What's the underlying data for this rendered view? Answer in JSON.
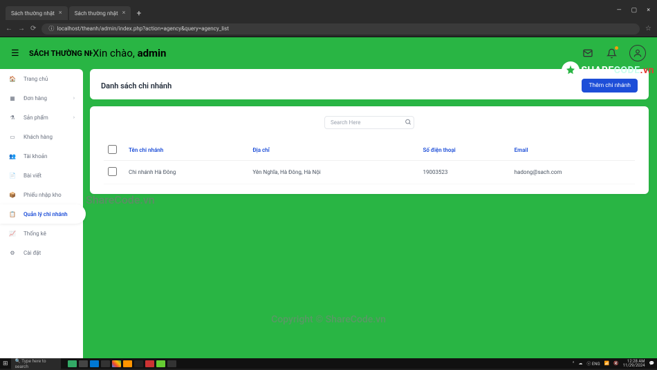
{
  "browser": {
    "tabs": [
      {
        "title": "Sách thường nhật"
      },
      {
        "title": "Sách thường nhật"
      }
    ],
    "url": "localhost/theanh/admin/index.php?action=agency&query=agency_list"
  },
  "header": {
    "brand": "SÁCH THƯỜNG NHẬT",
    "greeting_prefix": "Xin chào, ",
    "greeting_user": "admin"
  },
  "sidebar": {
    "items": [
      {
        "label": "Trang chủ",
        "icon": "home",
        "expandable": false
      },
      {
        "label": "Đơn hàng",
        "icon": "grid",
        "expandable": true
      },
      {
        "label": "Sản phẩm",
        "icon": "flask",
        "expandable": true
      },
      {
        "label": "Khách hàng",
        "icon": "card",
        "expandable": false
      },
      {
        "label": "Tài khoản",
        "icon": "users",
        "expandable": false
      },
      {
        "label": "Bài viết",
        "icon": "doc",
        "expandable": false
      },
      {
        "label": "Phiếu nhập kho",
        "icon": "box",
        "expandable": false
      },
      {
        "label": "Quản lý chi nhánh",
        "icon": "list",
        "expandable": false,
        "active": true
      },
      {
        "label": "Thống kê",
        "icon": "chart",
        "expandable": false
      },
      {
        "label": "Cài đặt",
        "icon": "gear",
        "expandable": false
      }
    ]
  },
  "page": {
    "title": "Danh sách chi nhánh",
    "add_button": "Thêm chi nhánh",
    "search_placeholder": "Search Here",
    "columns": {
      "name": "Tên chi nhánh",
      "address": "Địa chỉ",
      "phone": "Số điện thoại",
      "email": "Email"
    },
    "rows": [
      {
        "name": "Chi nhánh Hà Đông",
        "address": "Yên Nghĩa, Hà Đông, Hà Nội",
        "phone": "19003523",
        "email": "hadong@sach.com"
      }
    ]
  },
  "watermarks": {
    "wm1": "ShareCode.vn",
    "wm2": "Copyright © ShareCode.vn",
    "logo_share": "SHARE",
    "logo_code": "CODE",
    "logo_vn": ".vn"
  },
  "taskbar": {
    "search": "Type here to search",
    "time": "12:28 AM",
    "date": "11/29/2024"
  }
}
